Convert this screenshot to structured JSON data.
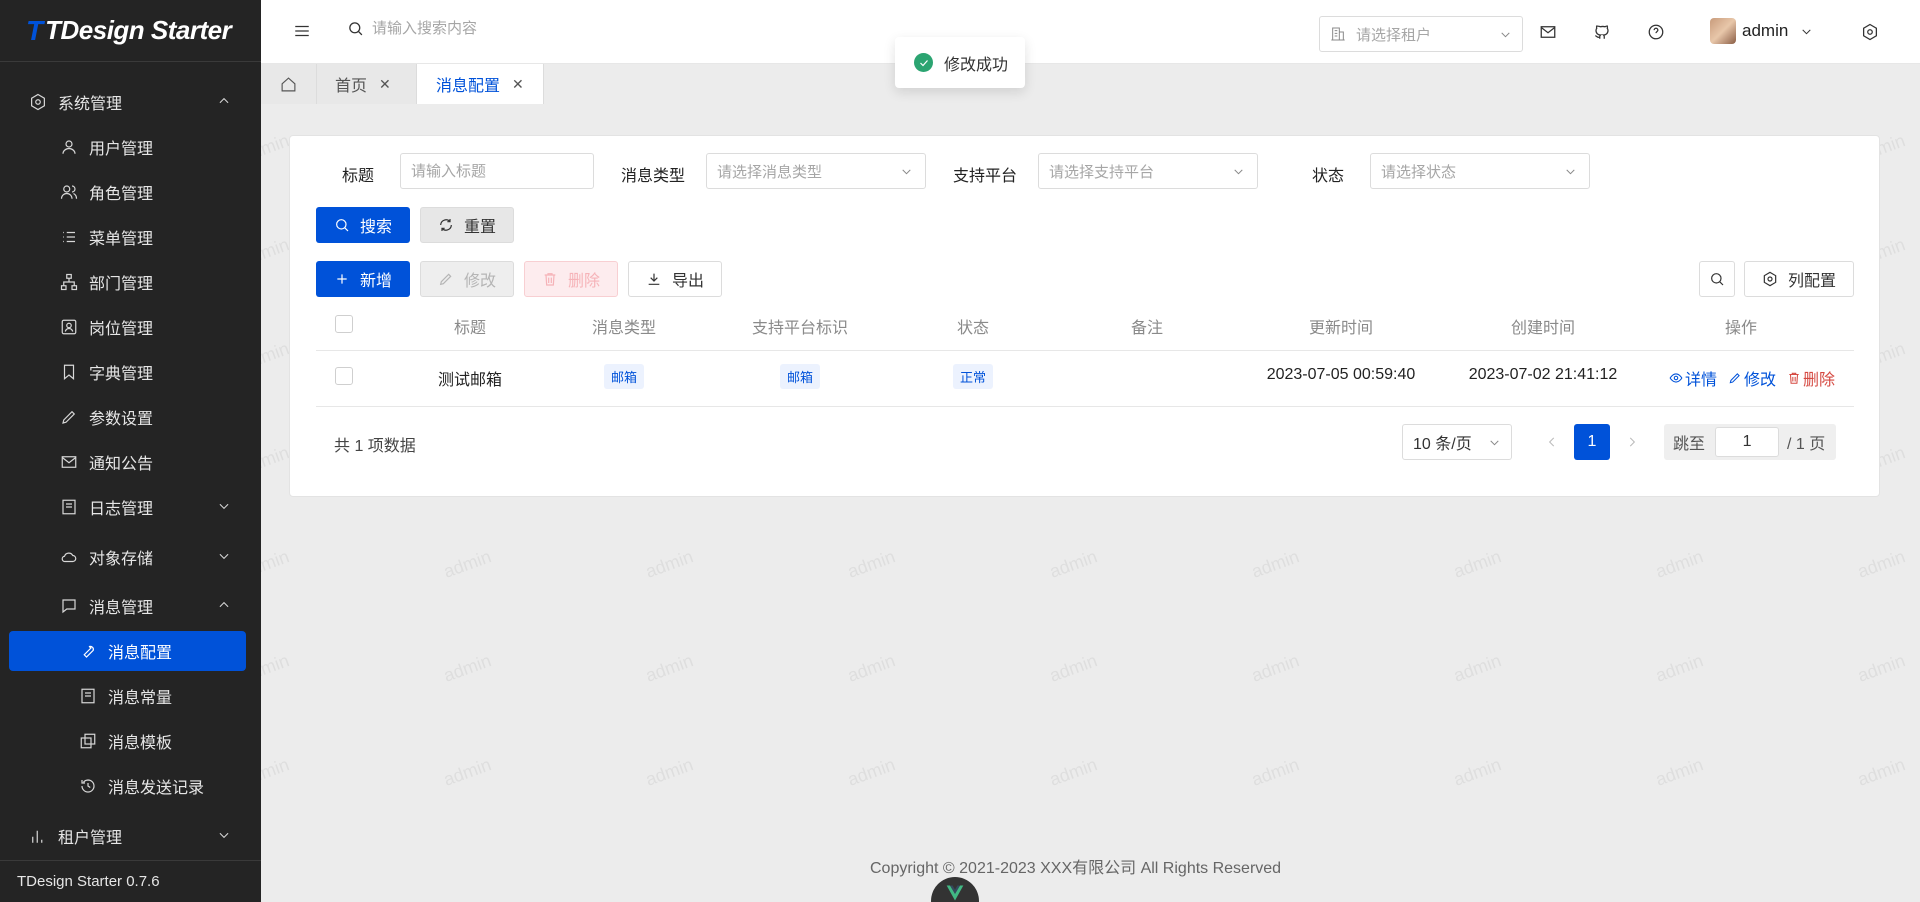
{
  "app": {
    "logo_mark": "T",
    "logo_text": "TDesign Starter",
    "version": "TDesign Starter 0.7.6"
  },
  "sidebar": {
    "items": [
      {
        "label": "系统管理",
        "icon": "gear-icon",
        "expanded": true
      },
      {
        "label": "用户管理",
        "icon": "user-icon"
      },
      {
        "label": "角色管理",
        "icon": "users-icon"
      },
      {
        "label": "菜单管理",
        "icon": "list-icon"
      },
      {
        "label": "部门管理",
        "icon": "tree-icon"
      },
      {
        "label": "岗位管理",
        "icon": "portrait-icon"
      },
      {
        "label": "字典管理",
        "icon": "bookmark-icon"
      },
      {
        "label": "参数设置",
        "icon": "pencil-icon"
      },
      {
        "label": "通知公告",
        "icon": "mail-icon"
      },
      {
        "label": "日志管理",
        "icon": "doc-icon",
        "expanded": false
      },
      {
        "label": "对象存储",
        "icon": "cloud-icon",
        "expanded": false
      },
      {
        "label": "消息管理",
        "icon": "chat-icon",
        "expanded": true
      },
      {
        "label": "消息配置",
        "icon": "wrench-icon",
        "active": true
      },
      {
        "label": "消息常量",
        "icon": "doc-icon"
      },
      {
        "label": "消息模板",
        "icon": "copy-icon"
      },
      {
        "label": "消息发送记录",
        "icon": "history-icon"
      },
      {
        "label": "租户管理",
        "icon": "chart-icon",
        "expanded": false
      }
    ]
  },
  "header": {
    "search_placeholder": "请输入搜索内容",
    "tenant_placeholder": "请选择租户",
    "username": "admin"
  },
  "tabs": [
    {
      "label": "首页"
    },
    {
      "label": "消息配置",
      "active": true
    }
  ],
  "toast": {
    "message": "修改成功"
  },
  "filters": {
    "title_label": "标题",
    "title_placeholder": "请输入标题",
    "type_label": "消息类型",
    "type_placeholder": "请选择消息类型",
    "platform_label": "支持平台",
    "platform_placeholder": "请选择支持平台",
    "status_label": "状态",
    "status_placeholder": "请选择状态"
  },
  "buttons": {
    "search": "搜索",
    "reset": "重置",
    "add": "新增",
    "edit": "修改",
    "delete": "删除",
    "export": "导出",
    "columns": "列配置"
  },
  "table": {
    "columns": [
      "标题",
      "消息类型",
      "支持平台标识",
      "状态",
      "备注",
      "更新时间",
      "创建时间",
      "操作"
    ],
    "rows": [
      {
        "title": "测试邮箱",
        "type": "邮箱",
        "platform": "邮箱",
        "status": "正常",
        "remark": "",
        "updated": "2023-07-05 00:59:40",
        "created": "2023-07-02 21:41:12",
        "ops": {
          "detail": "详情",
          "edit": "修改",
          "delete": "删除"
        }
      }
    ]
  },
  "pagination": {
    "total_text": "共 1 项数据",
    "page_size": "10 条/页",
    "current_page": "1",
    "jump_label": "跳至",
    "jump_value": "1",
    "total_pages": "/ 1 页"
  },
  "footer": {
    "copyright": "Copyright © 2021-2023 XXX有限公司 All Rights Reserved"
  },
  "watermark": "admin",
  "colors": {
    "primary": "#0052d9",
    "success": "#2ba471",
    "danger": "#d54941",
    "sidebar_bg": "#242424"
  }
}
